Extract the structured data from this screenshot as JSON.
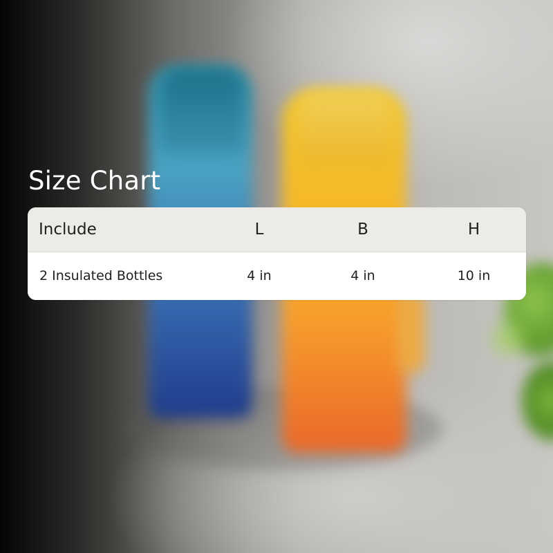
{
  "title": "Size Chart",
  "table": {
    "headers": [
      "Include",
      "L",
      "B",
      "H"
    ],
    "rows": [
      [
        "2 Insulated Bottles",
        "4 in",
        "4 in",
        "10 in"
      ]
    ]
  },
  "colors": {
    "title_text": "#ffffff",
    "header_bg": "#edebe7",
    "body_bg": "#ffffff",
    "text": "#1f1f1f"
  }
}
